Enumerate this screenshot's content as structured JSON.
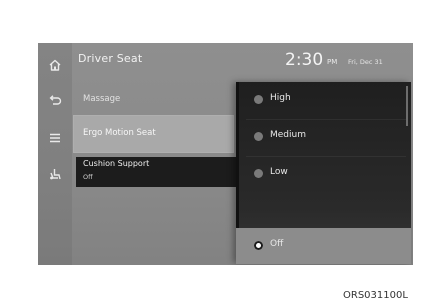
{
  "header": {
    "title": "Driver Seat",
    "time": "2:30",
    "ampm": "PM",
    "date": "Fri, Dec 31"
  },
  "sidenav": {
    "icons": [
      "home-icon",
      "back-icon",
      "menu-icon",
      "seat-settings-icon"
    ]
  },
  "menu": {
    "section_label": "Massage",
    "items": [
      {
        "label": "Ergo Motion Seat",
        "highlighted": true
      },
      {
        "label": "Cushion Support",
        "value": "Off"
      }
    ]
  },
  "popup": {
    "options": [
      {
        "label": "High",
        "selected": false
      },
      {
        "label": "Medium",
        "selected": false
      },
      {
        "label": "Low",
        "selected": false
      },
      {
        "label": "Off",
        "selected": true
      }
    ]
  },
  "caption": {
    "code": "ORS031100L"
  }
}
